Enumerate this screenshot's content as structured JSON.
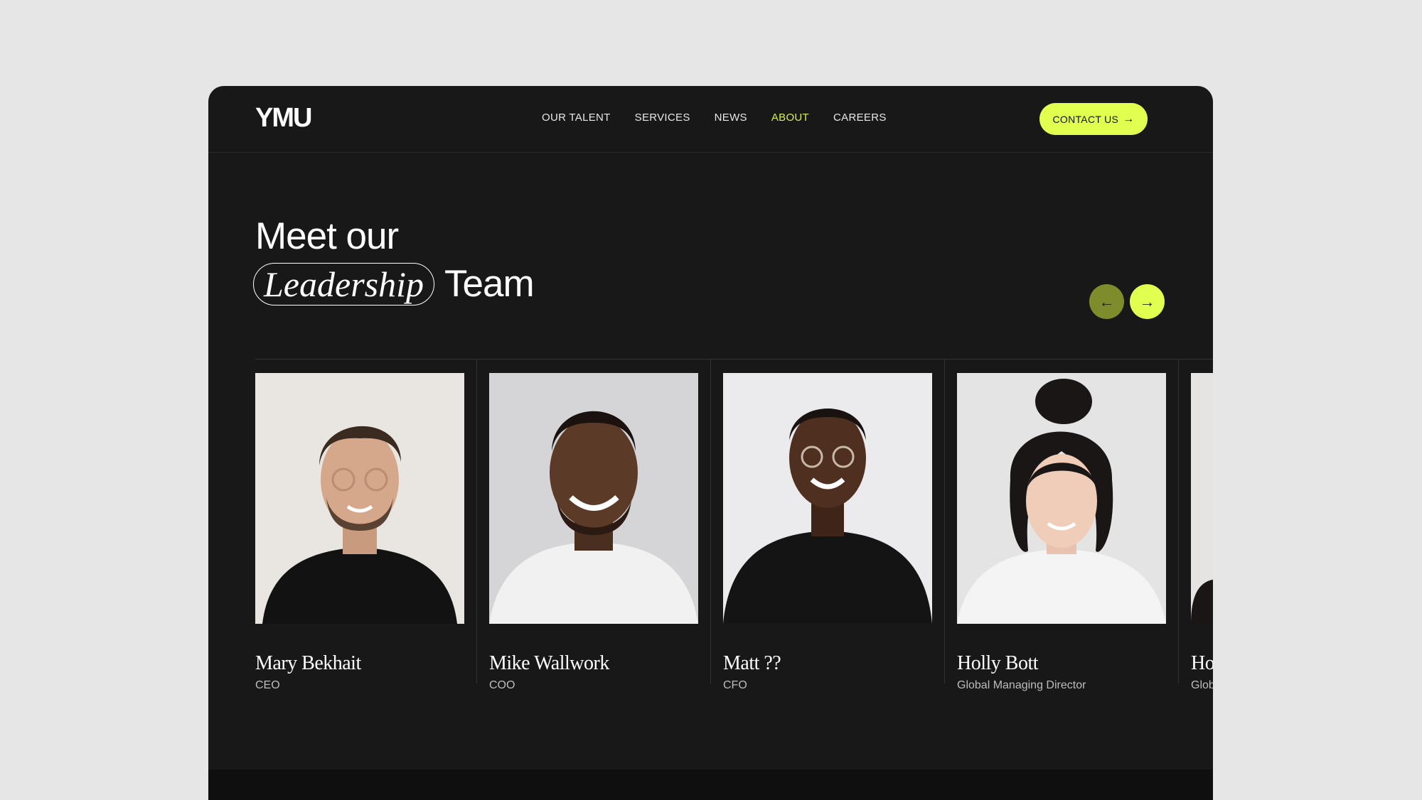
{
  "brand": {
    "logo": "YMU"
  },
  "nav": {
    "items": [
      {
        "label": "OUR TALENT"
      },
      {
        "label": "SERVICES"
      },
      {
        "label": "NEWS"
      },
      {
        "label": "ABOUT",
        "active": true
      },
      {
        "label": "CAREERS"
      }
    ],
    "contact_label": "CONTACT US",
    "accent_color": "#e0ff4f"
  },
  "heading": {
    "line1": "Meet our",
    "highlight": "Leadership",
    "line2_rest": "Team"
  },
  "carousel": {
    "prev_icon": "arrow-left-icon",
    "next_icon": "arrow-right-icon"
  },
  "team": [
    {
      "name": "Mary Bekhait",
      "role": "CEO"
    },
    {
      "name": "Mike Wallwork",
      "role": "COO"
    },
    {
      "name": "Matt ??",
      "role": "CFO"
    },
    {
      "name": "Holly Bott",
      "role": "Global Managing Director"
    },
    {
      "name": "Ho",
      "role": "Glob"
    }
  ]
}
